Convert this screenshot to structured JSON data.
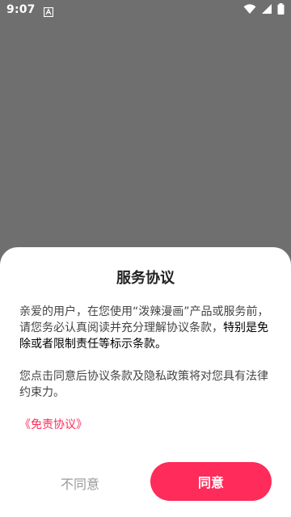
{
  "status_bar": {
    "time": "9:07"
  },
  "dialog": {
    "title": "服务协议",
    "paragraph1_normal": "亲爱的用户，在您使用“泼辣漫画”产品或服务前，请您务必认真阅读并充分理解协议条款，",
    "paragraph1_emphasis": "特别是免除或者限制责任等标示条款。",
    "paragraph2": "您点击同意后协议条款及隐私政策将对您具有法律约束力。",
    "link_text": "《免责协议》",
    "disagree_label": "不同意",
    "agree_label": "同意"
  },
  "colors": {
    "overlay": "#6f6f6f",
    "accent": "#ff2b5a",
    "disagree_text": "#999999"
  },
  "icons": [
    "a-notification-icon",
    "wifi-icon",
    "signal-icon",
    "battery-icon"
  ]
}
